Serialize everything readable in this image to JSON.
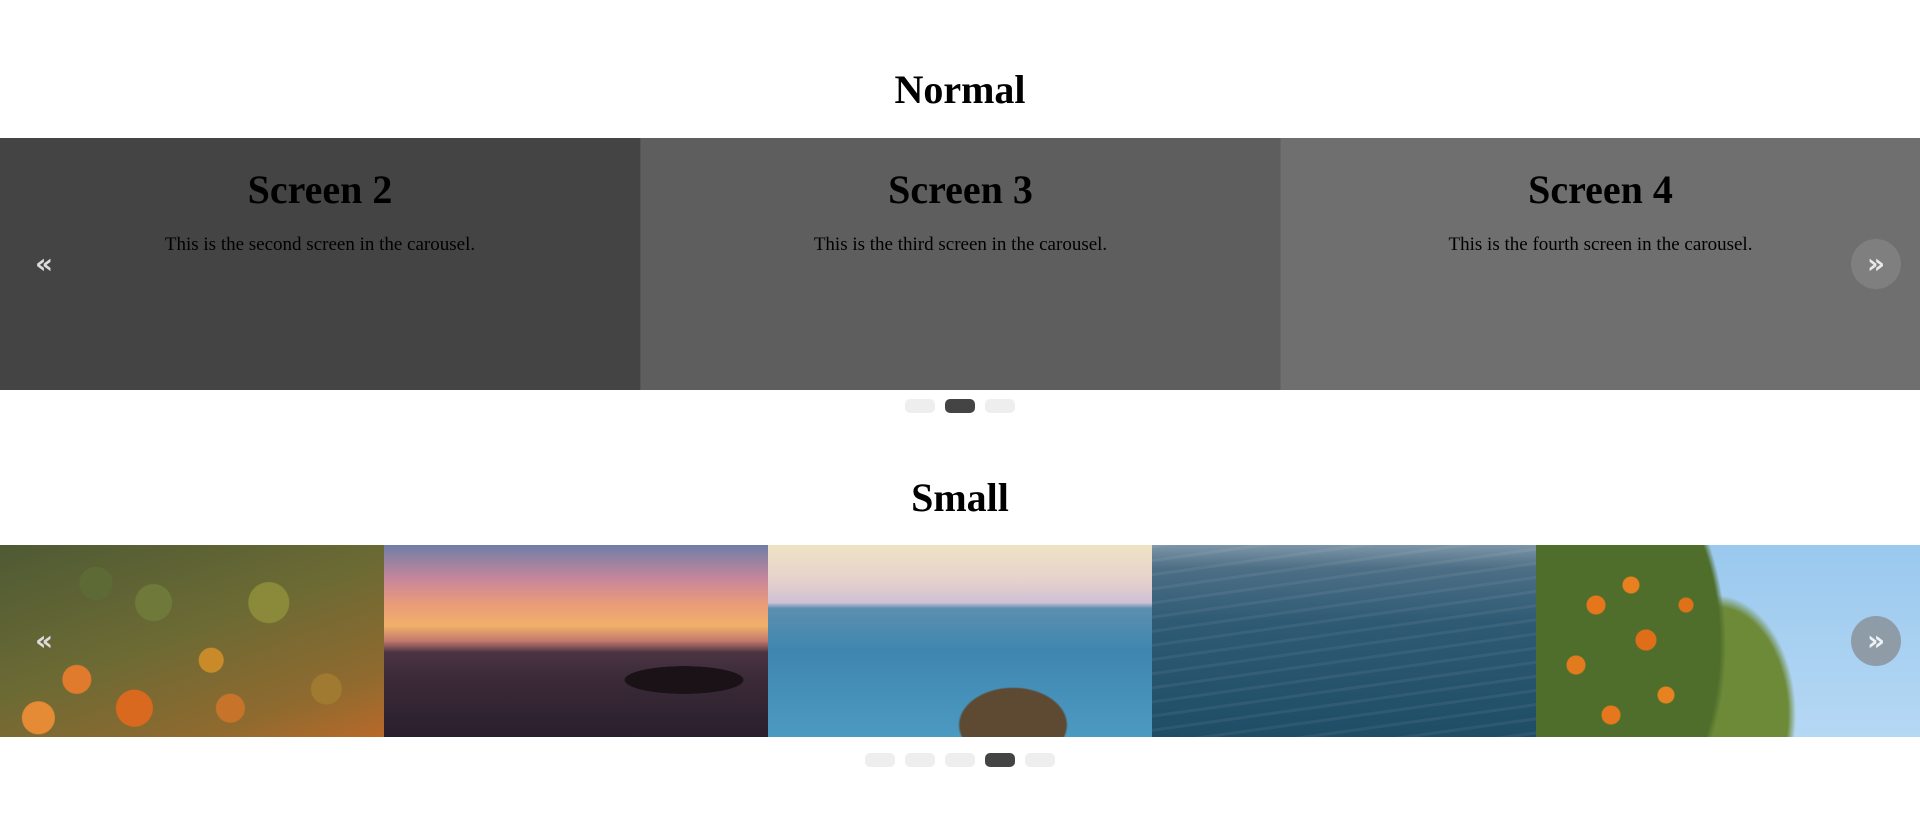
{
  "sections": {
    "normal": {
      "title": "Normal",
      "slides": [
        {
          "heading": "Screen 2",
          "text": "This is the second screen in the carousel."
        },
        {
          "heading": "Screen 3",
          "text": "This is the third screen in the carousel."
        },
        {
          "heading": "Screen 4",
          "text": "This is the fourth screen in the carousel."
        }
      ],
      "prev_label": "«",
      "next_label": "»",
      "dots": {
        "count": 3,
        "active_index": 1
      }
    },
    "small": {
      "title": "Small",
      "photos": [
        "forest-aerial",
        "sunset-sea",
        "sea-rock",
        "ocean-waves",
        "orange-tree"
      ],
      "prev_label": "«",
      "next_label": "»",
      "dots": {
        "count": 5,
        "active_index": 3
      }
    }
  },
  "colors": {
    "dot_inactive": "#eeeeee",
    "dot_active": "#444444",
    "slide_dark": "#444444",
    "slide_mid": "#5e5e5e",
    "slide_light": "#6f6f6f"
  }
}
